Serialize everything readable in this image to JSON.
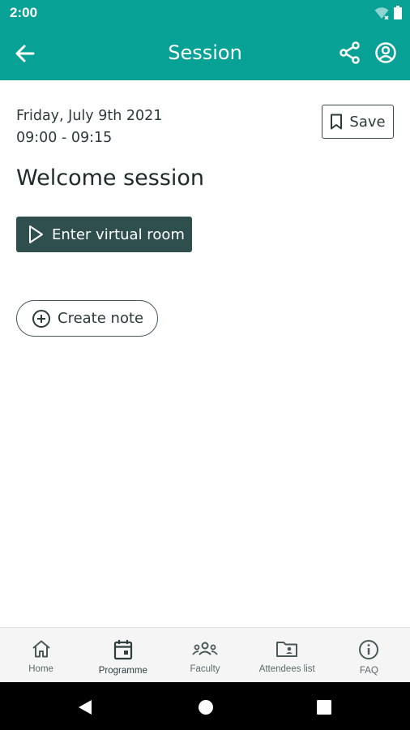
{
  "status_bar": {
    "time": "2:00"
  },
  "app_bar": {
    "title": "Session"
  },
  "session": {
    "date": "Friday, July 9th 2021",
    "time_range": "09:00 - 09:15",
    "title": "Welcome session",
    "save_label": "Save",
    "enter_room_label": "Enter virtual room",
    "create_note_label": "Create note"
  },
  "bottom_nav": {
    "items": [
      {
        "label": "Home",
        "icon": "home-icon"
      },
      {
        "label": "Programme",
        "icon": "calendar-icon",
        "active": true
      },
      {
        "label": "Faculty",
        "icon": "group-icon"
      },
      {
        "label": "Attendees list",
        "icon": "contacts-folder-icon"
      },
      {
        "label": "FAQ",
        "icon": "info-icon"
      }
    ]
  },
  "colors": {
    "primary": "#07a196",
    "button_dark": "#2f4f4f",
    "text": "#2d3a3a"
  }
}
